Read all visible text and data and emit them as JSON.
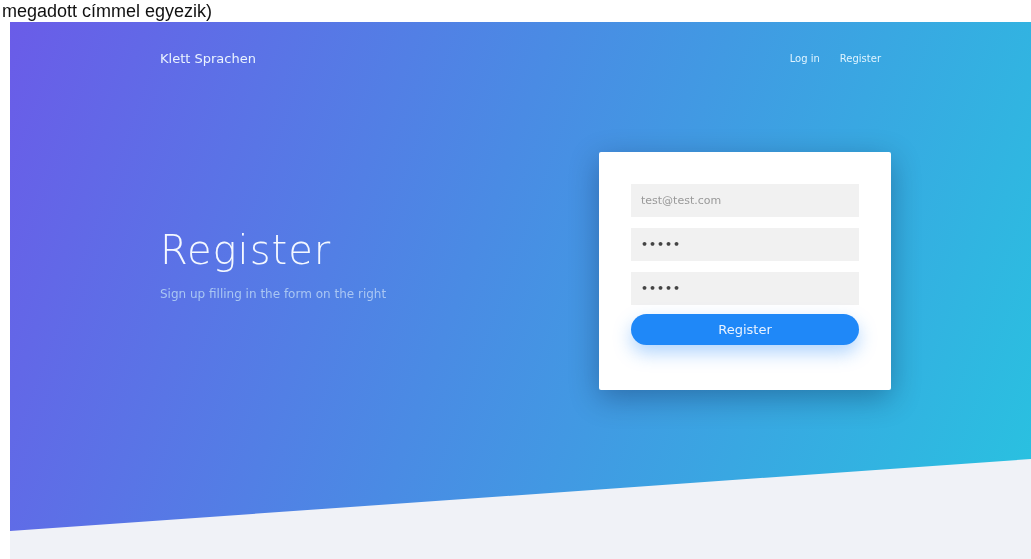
{
  "caption": "megadott címmel egyezik)",
  "nav": {
    "brand": "Klett Sprachen",
    "links": [
      "Log in",
      "Register"
    ]
  },
  "hero": {
    "title": "Register",
    "subtitle": "Sign up filling in the form on the right"
  },
  "form": {
    "fields": [
      {
        "kind": "email",
        "placeholder": "test@test.com"
      },
      {
        "kind": "password",
        "value": "•••••"
      },
      {
        "kind": "password",
        "value": "•••••"
      }
    ],
    "button": "Register"
  }
}
